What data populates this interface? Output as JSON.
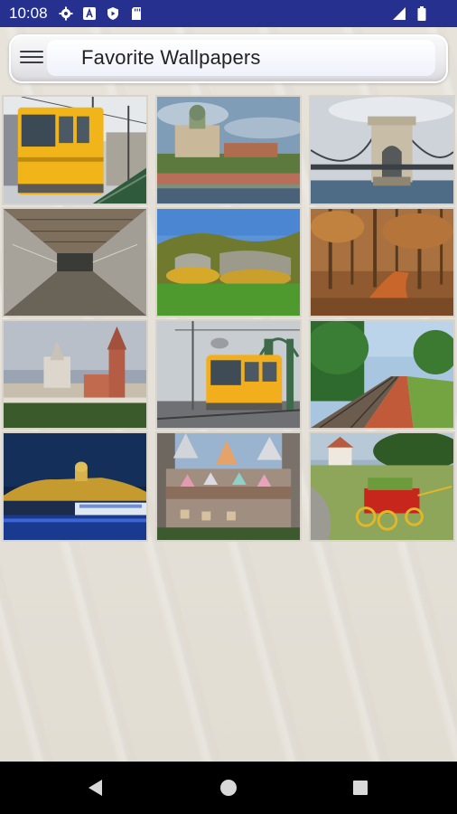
{
  "status_bar": {
    "time": "10:08",
    "left_icons": [
      "gear-icon",
      "a-icon",
      "shield-play-icon",
      "sd-card-icon"
    ],
    "right_icons": [
      "cell-signal-icon",
      "battery-icon"
    ]
  },
  "toolbar": {
    "title": "Favorite Wallpapers",
    "menu_icon": "hamburger-menu-icon"
  },
  "wallpapers": [
    {
      "subject": "yellow-tram"
    },
    {
      "subject": "basilica-hill"
    },
    {
      "subject": "chain-bridge"
    },
    {
      "subject": "tunnel-walkway"
    },
    {
      "subject": "autumn-hills"
    },
    {
      "subject": "autumn-forest-path"
    },
    {
      "subject": "city-churches"
    },
    {
      "subject": "tram-liberty-bridge"
    },
    {
      "subject": "railway-track"
    },
    {
      "subject": "castle-night"
    },
    {
      "subject": "umbrella-lamps-street"
    },
    {
      "subject": "cart-garden"
    }
  ],
  "navigation_bar": {
    "back": "back-triangle-icon",
    "home": "home-circle-icon",
    "recents": "recents-square-icon"
  },
  "colors": {
    "status_bar": "#26318f",
    "background": "#e7e3db",
    "nav_bar": "#000000"
  }
}
